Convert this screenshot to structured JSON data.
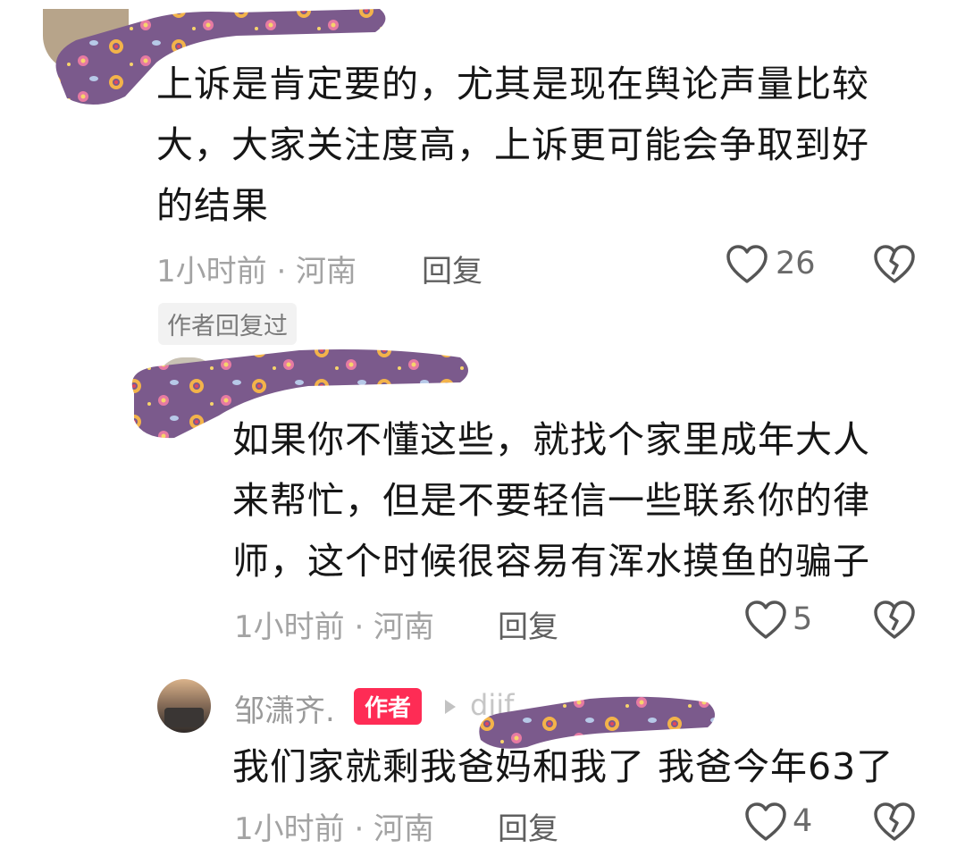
{
  "comments": [
    {
      "text_lines": [
        "上诉是肯定要的，尤其是现在舆论声量比较",
        "大，大家关注度高，上诉更可能会争取到好",
        "的结果"
      ],
      "time": "1小时前 · 河南",
      "reply": "回复",
      "likes": "26",
      "author_replied_tag": "作者回复过"
    },
    {
      "text_lines": [
        "如果你不懂这些，就找个家里成年大人",
        "来帮忙，但是不要轻信一些联系你的律",
        "师，这个时候很容易有浑水摸鱼的骗子"
      ],
      "time": "1小时前 · 河南",
      "reply": "回复",
      "likes": "5"
    },
    {
      "username": "邹潇齐.",
      "author_badge": "作者",
      "reply_target": "diif",
      "text_lines": [
        "我们家就剩我爸妈和我了 我爸今年63了"
      ],
      "time": "1小时前 · 河南",
      "reply": "回复",
      "likes": "4"
    }
  ],
  "colors": {
    "accent": "#fe2c55",
    "censor": "#7b5a8c",
    "meta_text": "#a3a3a3"
  },
  "icons": [
    "heart-outline-icon",
    "broken-heart-icon",
    "triangle-right-icon"
  ]
}
